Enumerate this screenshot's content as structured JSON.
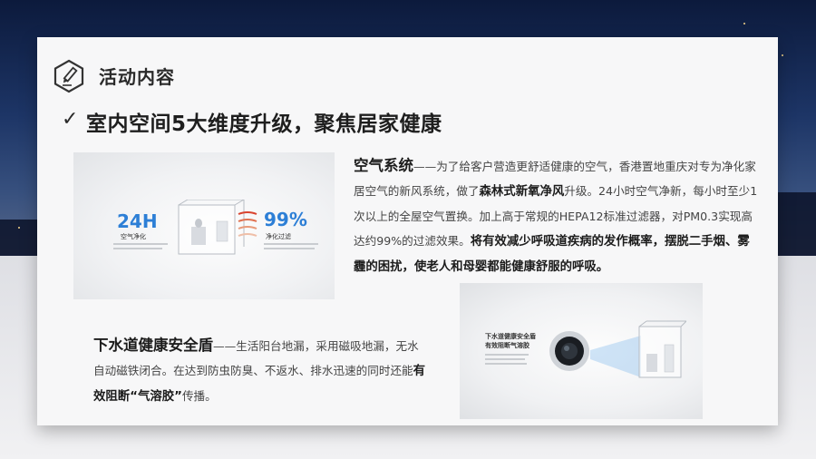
{
  "header": {
    "icon": "pencil-hexagon-icon",
    "title": "活动内容"
  },
  "subtitle": {
    "check": "✓",
    "text": "室内空间5大维度升级，聚焦居家健康"
  },
  "image1": {
    "big_left": "24H",
    "label_left": "空气净化",
    "big_right": "99%",
    "label_right": "净化过滤"
  },
  "image2": {
    "title_line1": "下水道健康安全盾",
    "title_line2": "有效阻断气溶胶"
  },
  "section1": {
    "lead": "空气系统",
    "t1": "——为了给客户营造更舒适健康的空气，香港置地重庆对专为净化家居空气的新风系统，做了",
    "b1": "森林式新氧净风",
    "t2": "升级。24小时空气净新，每小时至少1次以上的全屋空气置换。加上高于常规的HEPA12标准过滤器，对PM0.3实现高达约99%的过滤效果。",
    "b2": "将有效减少呼吸道疾病的发作概率，摆脱二手烟、雾霾的困扰，使老人和母婴都能健康舒服的呼吸。"
  },
  "section2": {
    "lead": "下水道健康安全盾",
    "t1": "——生活阳台地漏，采用磁吸地漏，无水自动磁铁闭合。在达到防虫防臭、不返水、排水迅速的同时还能",
    "b1": "有效阻断“气溶胶”",
    "t2": "传播。"
  },
  "colors": {
    "accent_blue": "#2d7fd6",
    "accent_red": "#d9442f",
    "text_dark": "#1c1c1c",
    "text_body": "#444444"
  }
}
